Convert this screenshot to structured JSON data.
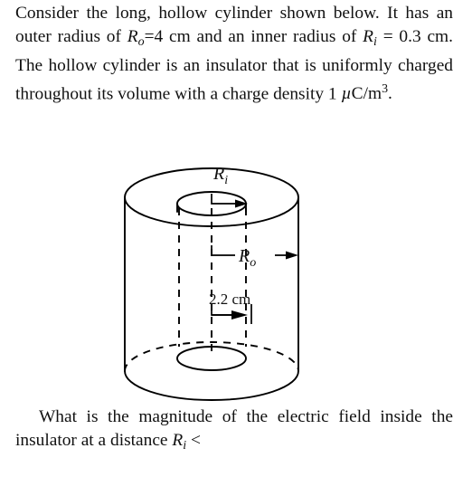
{
  "document": {
    "type": "physics-problem",
    "intro": {
      "text_plain": "Consider the long, hollow cylinder shown below. It has an outer radius of Ro=4 cm and an inner radius of Ri = 0.3 cm. The hollow cylinder is an insulator that is uniformly charged throughout its volume with a charge density 1 µC/m3.",
      "segments": {
        "s1": "Consider the long, hollow cylinder shown below.  It has an outer radius of ",
        "var_Ro": "R",
        "sub_o": "o",
        "s2": "=4 cm and an inner radius of ",
        "var_Ri": "R",
        "sub_i": "i",
        "s3": " = 0.3 cm.  The hollow cylinder is an insulator that is uniformly charged throughout its volume with a charge density 1 ",
        "mu": "µ",
        "s4": "C/m",
        "sup_3": "3",
        "s5": "."
      }
    },
    "question": {
      "text_plain": "What is the magnitude of the electric field inside the insulator at a distance Ri <",
      "segments": {
        "q1": "What is the magnitude of the electric field inside the insulator at a distance ",
        "var_R": "R",
        "sub_i": "i",
        "q2": " <"
      }
    }
  },
  "figure": {
    "name": "hollow-cylinder-diagram",
    "description": "Long hollow cylinder drawn in 3D with an axial cylindrical hole",
    "labels": {
      "inner_radius": {
        "symbol": "R",
        "subscript": "i"
      },
      "outer_radius": {
        "symbol": "R",
        "subscript": "o"
      },
      "distance": "2.2 cm"
    },
    "colors": {
      "stroke": "#000000",
      "background": "#ffffff"
    }
  },
  "values": {
    "outer_radius": "4 cm",
    "inner_radius": "0.3 cm",
    "charge_density": "1 µC/m3",
    "marked_distance": "2.2 cm"
  }
}
